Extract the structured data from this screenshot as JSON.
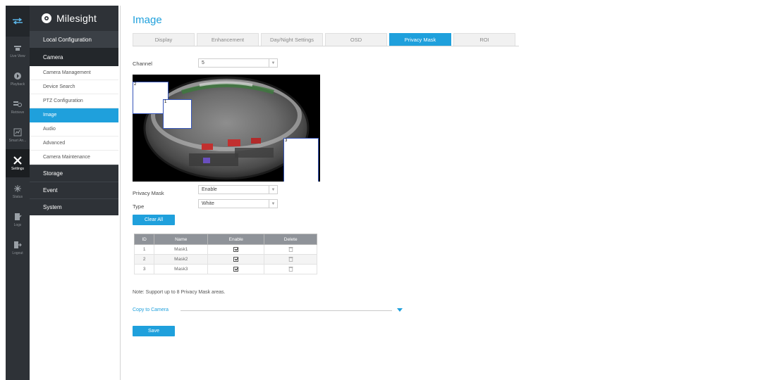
{
  "colors": {
    "accent": "#1fa0dc",
    "rail": "#2e3237",
    "mask_border": "#3453b8"
  },
  "brand": {
    "name": "Milesight",
    "icon": "milesight-logo-icon"
  },
  "rail": [
    {
      "label": "",
      "icon": "menu-toggle-icon"
    },
    {
      "label": "Live View",
      "icon": "live-view-icon"
    },
    {
      "label": "Playback",
      "icon": "playback-icon"
    },
    {
      "label": "Retrieve",
      "icon": "retrieve-icon"
    },
    {
      "label": "Smart An...",
      "icon": "smart-analysis-icon"
    },
    {
      "label": "Settings",
      "icon": "settings-icon"
    },
    {
      "label": "Status",
      "icon": "status-icon"
    },
    {
      "label": "Logs",
      "icon": "logs-icon"
    },
    {
      "label": "Logout",
      "icon": "logout-icon"
    }
  ],
  "nav": {
    "local": "Local Configuration",
    "camera": "Camera",
    "sub": [
      "Camera Management",
      "Device Search",
      "PTZ Configuration",
      "Image",
      "Audio",
      "Advanced",
      "Camera Maintenance"
    ],
    "storage": "Storage",
    "event": "Event",
    "system": "System"
  },
  "page": {
    "title": "Image",
    "tabs": [
      "Display",
      "Enhancement",
      "Day/Night Settings",
      "OSD",
      "Privacy Mask",
      "ROI"
    ],
    "active_tab": "Privacy Mask"
  },
  "form": {
    "channel_label": "Channel",
    "channel_value": "5",
    "privacy_mask_label": "Privacy Mask",
    "privacy_mask_value": "Enable",
    "type_label": "Type",
    "type_value": "White",
    "clear_all": "Clear All"
  },
  "preview_masks": [
    "2",
    "1",
    "3"
  ],
  "table": {
    "headers": [
      "ID",
      "Name",
      "Enable",
      "Delete"
    ],
    "rows": [
      {
        "id": "1",
        "name": "Mask1",
        "enabled": true
      },
      {
        "id": "2",
        "name": "Mask2",
        "enabled": true
      },
      {
        "id": "3",
        "name": "Mask3",
        "enabled": true
      }
    ]
  },
  "note": "Note: Support up to 8 Privacy Mask areas.",
  "copy_to_camera": "Copy to Camera",
  "save": "Save"
}
